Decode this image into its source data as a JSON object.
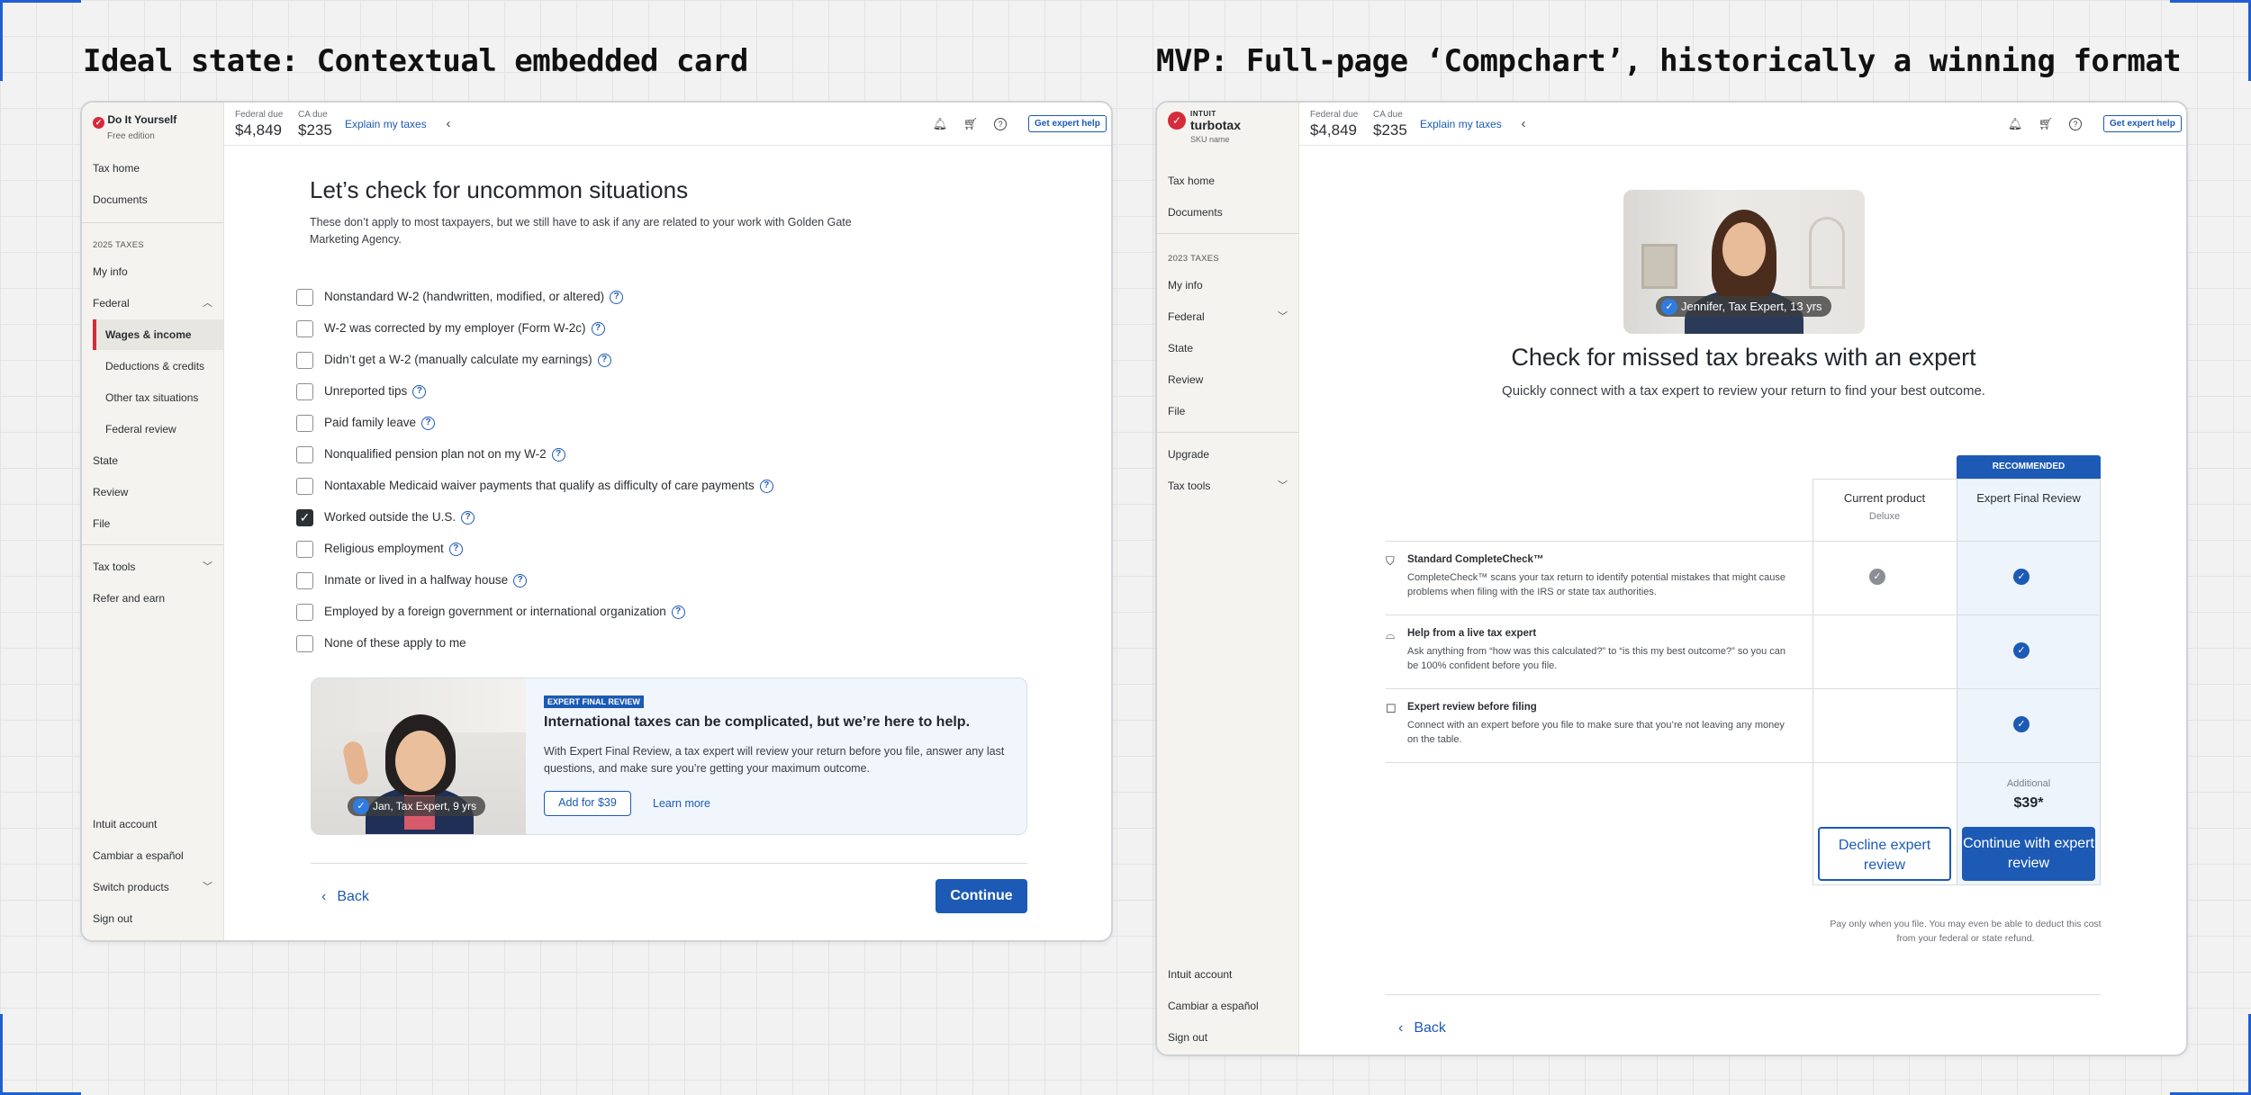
{
  "headings": {
    "left": "Ideal state: Contextual embedded card",
    "right": "MVP: Full-page ‘Compchart’, historically a winning format"
  },
  "accent": "#1c5ab5",
  "left": {
    "brand": {
      "name": "Do It Yourself",
      "edition": "Free edition"
    },
    "top": {
      "federal_label": "Federal due",
      "federal_amt": "$4,849",
      "ca_label": "CA due",
      "ca_amt": "$235",
      "explain": "Explain my taxes",
      "get_help": "Get expert help"
    },
    "nav": {
      "tax_home": "Tax home",
      "documents": "Documents",
      "section": "2025 TAXES",
      "my_info": "My info",
      "federal": "Federal",
      "wages": "Wages & income",
      "deductions": "Deductions & credits",
      "other": "Other tax situations",
      "federal_review": "Federal review",
      "state": "State",
      "review": "Review",
      "file": "File",
      "tax_tools": "Tax tools",
      "refer": "Refer and earn",
      "intuit_account": "Intuit account",
      "spanish": "Cambiar a español",
      "switch": "Switch products",
      "sign_out": "Sign out"
    },
    "main": {
      "title": "Let’s check for uncommon situations",
      "subtitle": "These don’t apply to most taxpayers, but we still have to ask if any are related to your work with Golden Gate Marketing Agency.",
      "options": [
        {
          "label": "Nonstandard W-2 (handwritten, modified, or altered)",
          "checked": false,
          "help": true
        },
        {
          "label": "W-2 was corrected by my employer (Form W-2c)",
          "checked": false,
          "help": true
        },
        {
          "label": "Didn’t get a W-2 (manually calculate my earnings)",
          "checked": false,
          "help": true
        },
        {
          "label": "Unreported tips",
          "checked": false,
          "help": true
        },
        {
          "label": "Paid family leave",
          "checked": false,
          "help": true
        },
        {
          "label": "Nonqualified pension plan not on my W-2",
          "checked": false,
          "help": true
        },
        {
          "label": "Nontaxable Medicaid waiver payments that qualify as difficulty of care payments",
          "checked": false,
          "help": true
        },
        {
          "label": "Worked outside the U.S.",
          "checked": true,
          "help": true
        },
        {
          "label": "Religious employment",
          "checked": false,
          "help": true
        },
        {
          "label": "Inmate or lived in a halfway house",
          "checked": false,
          "help": true
        },
        {
          "label": "Employed by a foreign government or international organization",
          "checked": false,
          "help": true
        },
        {
          "label": "None of these apply to me",
          "checked": false,
          "help": false
        }
      ],
      "card": {
        "tag": "EXPERT FINAL REVIEW",
        "title": "International taxes can be complicated, but we’re here to help.",
        "body": "With Expert Final Review, a tax expert will review your return before you file, answer any last questions, and make sure you’re getting your maximum outcome.",
        "add": "Add for $39",
        "learn": "Learn more",
        "expert": "Jan, Tax Expert, 9 yrs"
      },
      "back": "Back",
      "continue": "Continue"
    }
  },
  "right": {
    "brand": {
      "intuit": "INTUIT",
      "name": "turbotax",
      "sku": "SKU name"
    },
    "top": {
      "federal_label": "Federal due",
      "federal_amt": "$4,849",
      "ca_label": "CA due",
      "ca_amt": "$235",
      "explain": "Explain my taxes",
      "get_help": "Get expert help"
    },
    "nav": {
      "tax_home": "Tax home",
      "documents": "Documents",
      "section": "2023 TAXES",
      "my_info": "My info",
      "federal": "Federal",
      "state": "State",
      "review": "Review",
      "file": "File",
      "upgrade": "Upgrade",
      "tax_tools": "Tax tools",
      "intuit_account": "Intuit account",
      "spanish": "Cambiar a español",
      "sign_out": "Sign out"
    },
    "main": {
      "expert": "Jennifer, Tax Expert, 13 yrs",
      "title": "Check for missed tax breaks with an expert",
      "subtitle": "Quickly connect with a tax expert to review your return to find your best outcome.",
      "recommended": "RECOMMENDED",
      "col_current": "Current product",
      "col_current_sub": "Deluxe",
      "col_expert": "Expert Final Review",
      "features": [
        {
          "icon": "shield-check-icon",
          "title": "Standard CompleteCheck™",
          "desc": "CompleteCheck™ scans your tax return to identify potential mistakes that might cause problems when filing with the IRS or state tax authorities.",
          "current": true,
          "expert": true
        },
        {
          "icon": "glasses-icon",
          "title": "Help from a live tax expert",
          "desc": "Ask anything from “how was this calculated?” to “is this my best outcome?” so you can be 100% confident before you file.",
          "current": false,
          "expert": true
        },
        {
          "icon": "chat-review-icon",
          "title": "Expert review before filing",
          "desc": "Connect with an expert before you file to make sure that you’re not leaving any money on the table.",
          "current": false,
          "expert": true
        }
      ],
      "additional": "Additional",
      "price": "$39*",
      "decline": "Decline expert review",
      "continue": "Continue with expert review",
      "footnote": "Pay only when you file. You may even be able to deduct this cost from your federal or state refund.",
      "back": "Back"
    }
  }
}
